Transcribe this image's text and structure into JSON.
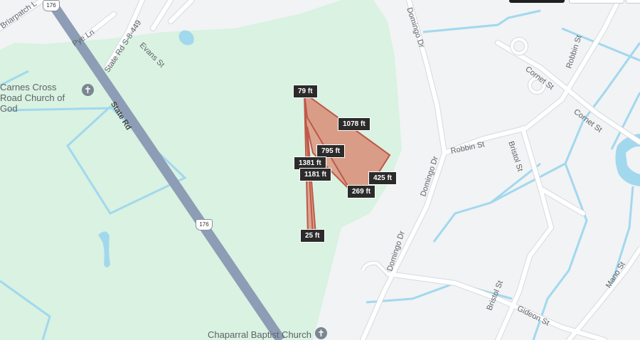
{
  "colors": {
    "land": "#f1f3f4",
    "park": "#d9f2e1",
    "road": "#ffffff",
    "road_edge": "#d6dade",
    "highway": "#8d9db5",
    "water": "#a2d8ee",
    "area_fill": "#d99d87",
    "area_stroke": "#c0584a"
  },
  "roads": {
    "state_rd": "State Rd",
    "state_rd_s": "State Rd S-8-449",
    "pye_ln": "Pye Ln",
    "evans_st": "Evans St",
    "briarpatch": "Briarpatch L",
    "domingo_dr_top": "Domingo Dr",
    "domingo_dr_mid": "Domingo Dr",
    "domingo_dr_low": "Domingo Dr",
    "robbin_st_top": "Robbin St",
    "robbin_st": "Robbin St",
    "cornet_st_top": "Cornet St",
    "cornet_st": "Cornet St",
    "bristol_st_top": "Bristol St",
    "bristol_st_low": "Bristol St",
    "gideon_st": "Gideon St",
    "mano_st": "Mano St"
  },
  "shields": {
    "top": "176",
    "mid": "176"
  },
  "pois": {
    "church1": "Carnes Cross Road Church of God",
    "church1_icon": "cross-icon",
    "church2": "Chaparral Baptist Church",
    "church2_icon": "cross-icon"
  },
  "measurements": {
    "m79": "79 ft",
    "m1078": "1078 ft",
    "m795": "795 ft",
    "m1381": "1381 ft",
    "m1181": "1181 ft",
    "m425": "425 ft",
    "m269": "269 ft",
    "m25": "25 ft"
  }
}
